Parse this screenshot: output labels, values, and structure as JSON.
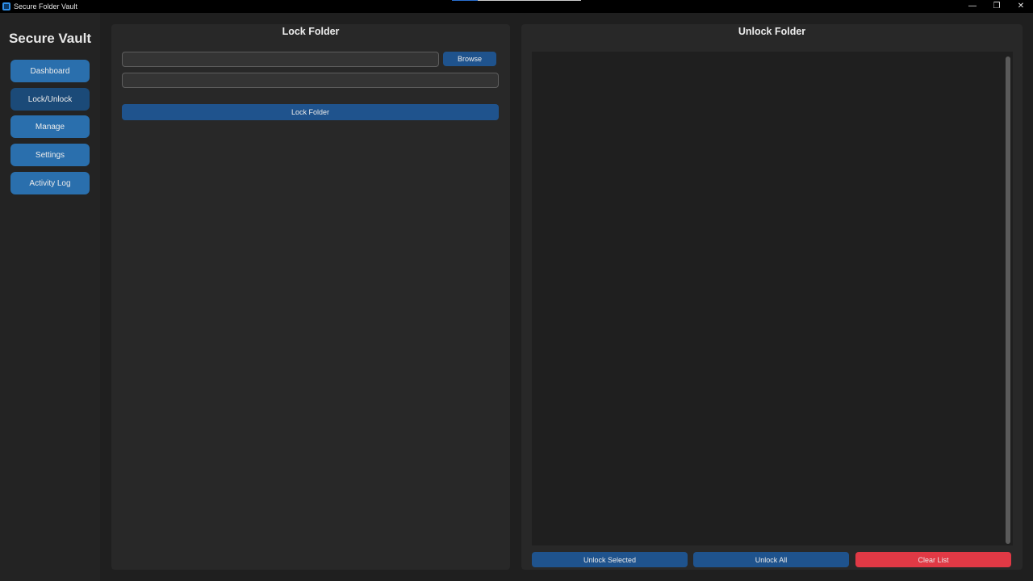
{
  "window": {
    "title": "Secure Folder Vault",
    "controls": {
      "minimize": "—",
      "restore": "❐",
      "close": "✕"
    }
  },
  "sidebar": {
    "brand": "Secure Vault",
    "items": [
      {
        "label": "Dashboard",
        "active": false
      },
      {
        "label": "Lock/Unlock",
        "active": true
      },
      {
        "label": "Manage",
        "active": false
      },
      {
        "label": "Settings",
        "active": false
      },
      {
        "label": "Activity Log",
        "active": false
      }
    ]
  },
  "lock_panel": {
    "title": "Lock Folder",
    "path_input": {
      "value": "",
      "placeholder": ""
    },
    "password_input": {
      "value": "",
      "placeholder": ""
    },
    "browse_label": "Browse",
    "lock_label": "Lock Folder"
  },
  "unlock_panel": {
    "title": "Unlock Folder",
    "locked_items": [],
    "unlock_selected_label": "Unlock Selected",
    "unlock_all_label": "Unlock All",
    "clear_list_label": "Clear List"
  },
  "colors": {
    "accent": "#1f538d",
    "nav": "#2a6fad",
    "nav_active": "#1b4a78",
    "danger": "#e03945",
    "background": "#1f1f1f",
    "panel": "#282828"
  }
}
